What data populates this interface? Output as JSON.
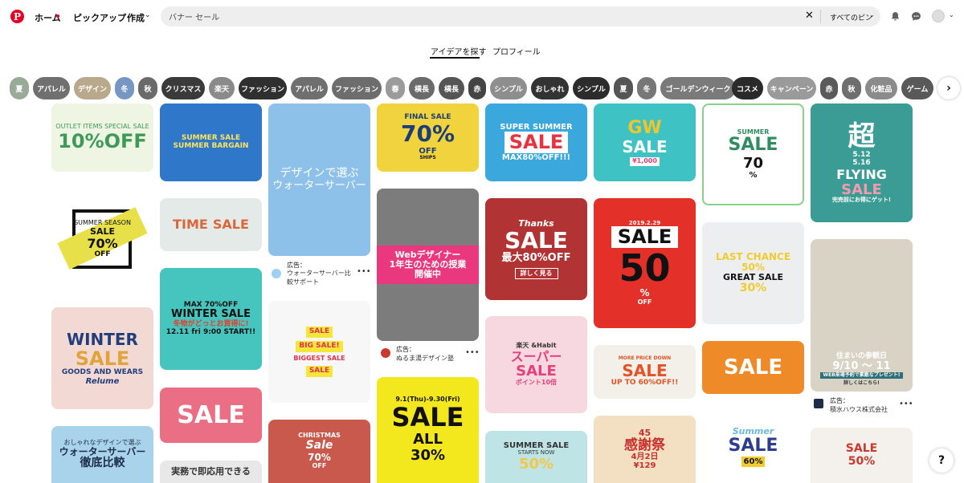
{
  "header": {
    "nav": [
      "ホーム",
      "ピックアップ",
      "作成"
    ],
    "search_value": "バナー セール",
    "search_scope": "すべてのピン"
  },
  "tabs": [
    "アイデアを探す",
    "プロフィール"
  ],
  "chips": [
    {
      "label": "夏",
      "color": "#9aaa98"
    },
    {
      "label": "アパレル",
      "color": "#707070"
    },
    {
      "label": "デザイン",
      "color": "#b9a98c"
    },
    {
      "label": "冬",
      "color": "#7696c3"
    },
    {
      "label": "秋",
      "color": "#6a6a6a"
    },
    {
      "label": "クリスマス",
      "color": "#3a3a3a"
    },
    {
      "label": "楽天",
      "color": "#8a8a8a"
    },
    {
      "label": "ファッション",
      "color": "#2f2f2f"
    },
    {
      "label": "アパレル",
      "color": "#6f6f6f"
    },
    {
      "label": "ファッション",
      "color": "#6d6d6d"
    },
    {
      "label": "春",
      "color": "#9b9b9b"
    },
    {
      "label": "横長",
      "color": "#6b6b6b"
    },
    {
      "label": "横長",
      "color": "#555555"
    },
    {
      "label": "赤",
      "color": "#444444"
    },
    {
      "label": "シンプル",
      "color": "#8e8e8e"
    },
    {
      "label": "おしゃれ",
      "color": "#333333"
    },
    {
      "label": "シンプル",
      "color": "#2c2c2c"
    },
    {
      "label": "夏",
      "color": "#555555"
    },
    {
      "label": "冬",
      "color": "#777777"
    },
    {
      "label": "ゴールデンウィーク",
      "color": "#7a7a7a"
    },
    {
      "label": "コスメ",
      "color": "#2a2a2a"
    },
    {
      "label": "キャンペーン",
      "color": "#9a9a9a"
    },
    {
      "label": "赤",
      "color": "#5a5a5a"
    },
    {
      "label": "秋",
      "color": "#6e6e6e"
    },
    {
      "label": "化粧品",
      "color": "#8b8b8b"
    },
    {
      "label": "ゲーム",
      "color": "#595959"
    }
  ],
  "pins": [
    {
      "lines": [
        "OUTLET ITEMS SPECIAL SALE",
        "10%OFF"
      ],
      "bg": "#eef5e2",
      "fg": "#3f9a5a"
    },
    {
      "lines": [
        "SUMMER SEASON",
        "SALE",
        "70%",
        "OFF"
      ],
      "bg": "#ffffff",
      "fg": "#111111"
    },
    {
      "lines": [
        "WINTER",
        "SALE",
        "GOODS AND WEARS",
        "Relume"
      ],
      "bg": "#f2d9d4",
      "fg": "#223e7a"
    },
    {
      "lines": [
        "おしゃれなデザインで選ぶ",
        "ウォーターサーバー",
        "徹底比較"
      ],
      "bg": "#a9d3ea",
      "fg": "#1d2d4a"
    },
    {
      "lines": [
        "SUMMER SALE",
        "SUMMER BARGAIN"
      ],
      "bg": "#2f78c9",
      "fg": "#ffe35a"
    },
    {
      "lines": [
        "TIME",
        "SALE"
      ],
      "bg": "#e4eae8",
      "fg": "#d9673b"
    },
    {
      "lines": [
        "MAX 70%OFF",
        "WINTER SALE",
        "冬物がどっとお買得に!",
        "12.11 fri 9:00 START!!"
      ],
      "bg": "#46c4be",
      "fg": "#e33f2c"
    },
    {
      "lines": [
        "SALE"
      ],
      "bg": "#ea6f84",
      "fg": "#ffffff"
    },
    {
      "lines": [
        "実務で即応用できる"
      ],
      "bg": "#e8e8e8",
      "fg": "#333333"
    },
    {
      "lines": [
        "デザインで選ぶ",
        "ウォーターサーバー"
      ],
      "bg": "#8ec1ea",
      "fg": "#ffffff"
    },
    {
      "lines": [
        "SALE",
        "BIG SALE!",
        "BIGGEST SALE",
        "SALE"
      ],
      "bg": "#f7f7f7",
      "fg": "#e2324b"
    },
    {
      "lines": [
        "CHRISTMAS",
        "Sale",
        "70%",
        "OFF"
      ],
      "bg": "#c8594c",
      "fg": "#ffffff"
    },
    {
      "lines": [
        "FINAL SALE",
        "70%",
        "OFF",
        "SHIPS"
      ],
      "bg": "#f1d43d",
      "fg": "#1c3d7a"
    },
    {
      "lines": [
        "Webデザイナー",
        "1年生のための授業",
        "開催中"
      ],
      "bg": "#7c7c7c",
      "fg": "#ffffff"
    },
    {
      "lines": [
        "9.1(Thu)-9.30(Fri)",
        "SALE",
        "ALL",
        "30%"
      ],
      "bg": "#f3e81e",
      "fg": "#111111"
    },
    {
      "lines": [
        "SUPER SUMMER",
        "SALE",
        "MAX80%OFF!!!"
      ],
      "bg": "#3aa7dd",
      "fg": "#e8323f"
    },
    {
      "lines": [
        "Thanks",
        "SALE",
        "最大80%OFF",
        "詳しく見る"
      ],
      "bg": "#b23333",
      "fg": "#ffffff"
    },
    {
      "lines": [
        "楽天 &Habit",
        "スーパー",
        "SALE",
        "ポイント10倍"
      ],
      "bg": "#f7d8e0",
      "fg": "#e4407b"
    },
    {
      "lines": [
        "SUMMER SALE",
        "STARTS NOW",
        "50%"
      ],
      "bg": "#bfe4e6",
      "fg": "#333333"
    },
    {
      "lines": [
        "GW",
        "SALE",
        "¥1,000"
      ],
      "bg": "#3ec2c3",
      "fg": "#f0c62a"
    },
    {
      "lines": [
        "2019.2.29",
        "SALE",
        "50",
        "%",
        "OFF"
      ],
      "bg": "#e33129",
      "fg": "#ffffff"
    },
    {
      "lines": [
        "MORE PRICE DOWN",
        "SALE",
        "UP TO 60%OFF!!"
      ],
      "bg": "#f2f0e8",
      "fg": "#e45327"
    },
    {
      "lines": [
        "45",
        "感謝祭",
        "4月2日",
        "¥129"
      ],
      "bg": "#f3dfc1",
      "fg": "#c8302e"
    },
    {
      "lines": [
        "SUMMER",
        "SALE",
        "70",
        "%"
      ],
      "bg": "#ffffff",
      "fg": "#2f8d61"
    },
    {
      "lines": [
        "LAST CHANCE",
        "50%",
        "GREAT SALE",
        "30%"
      ],
      "bg": "#eceeef",
      "fg": "#f2cb2e"
    },
    {
      "lines": [
        "SALE"
      ],
      "bg": "#ef8a28",
      "fg": "#ffffff"
    },
    {
      "lines": [
        "Summer",
        "SALE",
        "60%"
      ],
      "bg": "#ffffff",
      "fg": "#2e3d8f"
    },
    {
      "lines": [
        "超",
        "5.12",
        "5.16",
        "FLYING",
        "SALE",
        "完売前にお得にゲット!"
      ],
      "bg": "#3a9c94",
      "fg": "#ffffff"
    },
    {
      "lines": [
        "住まいの参観日",
        "9/10 ～ 11",
        "WEB来場予約で素敵なプレゼント!"
      ],
      "bg": "#d9d3c6",
      "fg": "#ffffff"
    },
    {
      "lines": [
        "SALE",
        "50%"
      ],
      "bg": "#f4f1ec",
      "fg": "#c9392d"
    }
  ],
  "ads": [
    {
      "label": "広告：",
      "name": "ウォーターサーバー比較サポート",
      "dots": "•••"
    },
    {
      "label": "広告：",
      "name": "ぬるま湯デザイン塾",
      "dots": "•••"
    },
    {
      "label": "広告：",
      "name": "積水ハウス株式会社",
      "dots": "•••",
      "extra": "詳しくはこちら!"
    }
  ],
  "help": "?"
}
